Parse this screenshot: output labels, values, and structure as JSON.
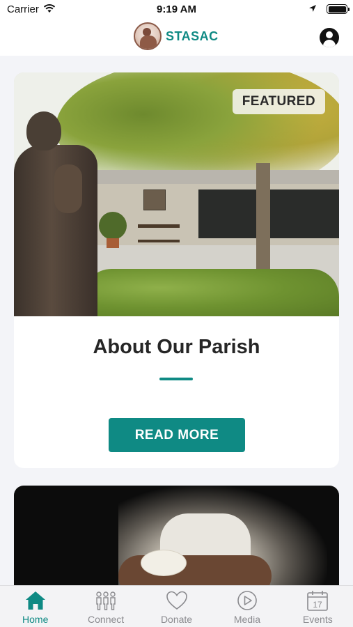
{
  "status_bar": {
    "carrier": "Carrier",
    "time": "9:19 AM"
  },
  "header": {
    "logo_text": "STASAC"
  },
  "featured_card": {
    "badge": "FEATURED",
    "title": "About Our Parish",
    "button_label": "READ MORE"
  },
  "colors": {
    "accent": "#0f8a84",
    "tab_inactive": "#8a8a8e",
    "background": "#f3f4f8"
  },
  "tab_bar": {
    "items": [
      {
        "label": "Home",
        "icon": "home-icon",
        "active": true
      },
      {
        "label": "Connect",
        "icon": "people-icon",
        "active": false
      },
      {
        "label": "Donate",
        "icon": "heart-icon",
        "active": false
      },
      {
        "label": "Media",
        "icon": "play-icon",
        "active": false
      },
      {
        "label": "Events",
        "icon": "calendar-icon",
        "active": false
      }
    ],
    "events_calendar_day": "17"
  }
}
